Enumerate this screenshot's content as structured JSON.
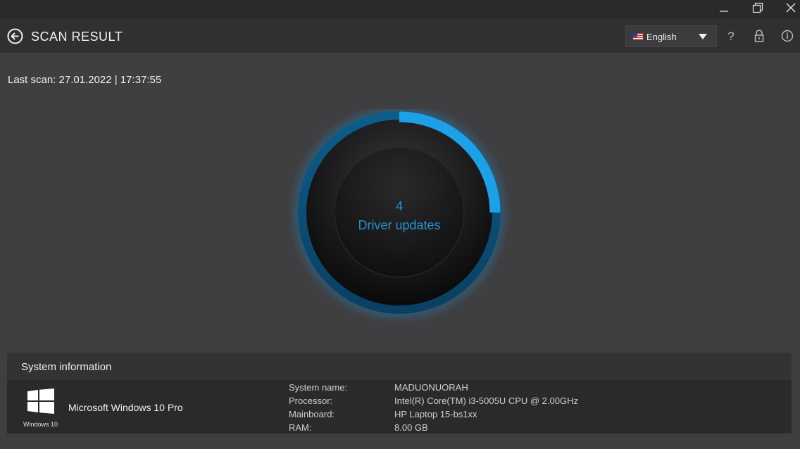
{
  "header": {
    "title": "SCAN RESULT",
    "language": "English"
  },
  "last_scan": "Last scan: 27.01.2022 | 17:37:55",
  "gauge": {
    "count": "4",
    "label": "Driver updates",
    "progress_fraction": 0.25,
    "accent_color": "#1ea0e6"
  },
  "sysinfo": {
    "title": "System information",
    "os_name": "Microsoft Windows 10 Pro",
    "os_caption": "Windows 10",
    "rows": [
      {
        "label": "System name:",
        "value": "MADUONUORAH"
      },
      {
        "label": "Processor:",
        "value": "Intel(R) Core(TM) i3-5005U CPU @ 2.00GHz"
      },
      {
        "label": "Mainboard:",
        "value": "HP Laptop 15-bs1xx"
      },
      {
        "label": "RAM:",
        "value": "8.00 GB"
      }
    ]
  },
  "icons": {
    "back": "back-arrow-icon",
    "help": "question-icon",
    "lock": "lock-icon",
    "info": "info-icon"
  }
}
